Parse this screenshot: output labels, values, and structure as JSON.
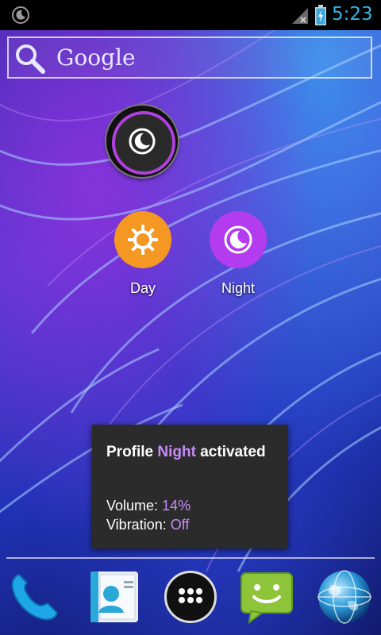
{
  "status_bar": {
    "notification_icon": "moon-icon",
    "signal_icon": "signal-no-data-icon",
    "battery_icon": "battery-charging-icon",
    "time": "5:23",
    "time_color": "#33b5e5"
  },
  "search_widget": {
    "icon": "search-icon",
    "label": "Google"
  },
  "profile_widget": {
    "icon": "moon-icon",
    "ring_color": "#b040e0"
  },
  "shortcuts": [
    {
      "label": "Day",
      "icon": "sun-gear-icon",
      "color": "#f49723"
    },
    {
      "label": "Night",
      "icon": "moon-icon",
      "color": "#b33cf0"
    }
  ],
  "toast": {
    "title_prefix": "Profile ",
    "title_profile": "Night",
    "title_suffix": " activated",
    "volume_label": "Volume: ",
    "volume_value": "14%",
    "vibration_label": "Vibration: ",
    "vibration_value": "Off",
    "accent_color": "#c58af8"
  },
  "dock": {
    "items": [
      {
        "icon": "phone-icon"
      },
      {
        "icon": "contacts-icon"
      },
      {
        "icon": "all-apps-icon"
      },
      {
        "icon": "messaging-icon"
      },
      {
        "icon": "browser-globe-icon"
      }
    ]
  }
}
